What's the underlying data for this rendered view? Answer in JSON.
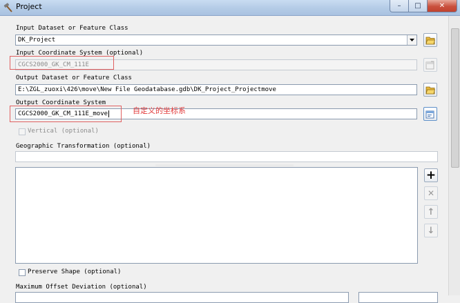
{
  "window": {
    "title": "Project",
    "minimize_glyph": "–",
    "maximize_glyph": "□",
    "close_glyph": "✕"
  },
  "input_dataset": {
    "label": "Input Dataset or Feature Class",
    "value": "DK_Project"
  },
  "input_cs": {
    "label": "Input Coordinate System (optional)",
    "value": "CGCS2000_GK_CM_111E"
  },
  "output_dataset": {
    "label": "Output Dataset or Feature Class",
    "value": "E:\\ZGL_zuoxi\\426\\move\\New File Geodatabase.gdb\\DK_Project_Projectmove"
  },
  "output_cs": {
    "label": "Output Coordinate System",
    "value": "CGCS2000_GK_CM_111E_move",
    "annotation": "自定义的坐标系"
  },
  "vertical": {
    "label": "Vertical (optional)"
  },
  "geo_transform": {
    "label": "Geographic Transformation (optional)"
  },
  "preserve_shape": {
    "label": "Preserve Shape (optional)"
  },
  "max_offset": {
    "label": "Maximum Offset Deviation (optional)"
  },
  "list_buttons": {
    "add_glyph": "+",
    "remove_glyph": "✕",
    "up_glyph": "↑",
    "down_glyph": "↓"
  },
  "colors": {
    "annotation_red": "#e23c3c",
    "titlebar": "#b4cbe6"
  }
}
